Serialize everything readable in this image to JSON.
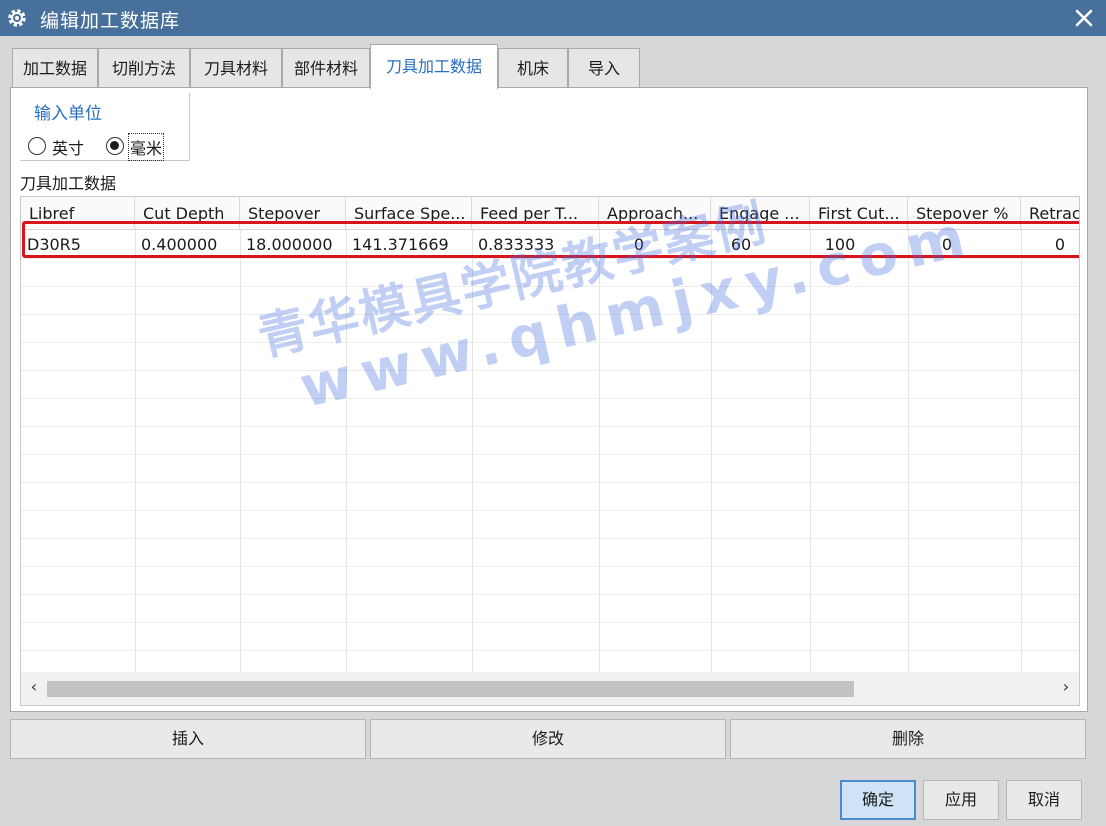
{
  "window": {
    "title": "编辑加工数据库",
    "icons": {
      "app": "gear-icon",
      "close": "close-icon"
    },
    "title_bar_color": "#47719c"
  },
  "tabs": [
    {
      "label": "加工数据",
      "active": false
    },
    {
      "label": "切削方法",
      "active": false
    },
    {
      "label": "刀具材料",
      "active": false
    },
    {
      "label": "部件材料",
      "active": false
    },
    {
      "label": "刀具加工数据",
      "active": true
    },
    {
      "label": "机床",
      "active": false
    },
    {
      "label": "导入",
      "active": false
    }
  ],
  "input_unit": {
    "title": "输入单位",
    "options": [
      {
        "label": "英寸",
        "selected": false
      },
      {
        "label": "毫米",
        "selected": true
      }
    ]
  },
  "table": {
    "section_label": "刀具加工数据",
    "columns": [
      "Libref",
      "Cut Depth",
      "Stepover",
      "Surface Spe...",
      "Feed per T...",
      "Approach...",
      "Engage ...",
      "First Cut...",
      "Stepover %",
      "Retrac"
    ],
    "rows": [
      [
        "D30R5",
        "0.400000",
        "18.000000",
        "141.371669",
        "0.833333",
        "0",
        "60",
        "100",
        "0",
        "0"
      ]
    ],
    "highlight_color": "#d9141b",
    "scroll_icons": {
      "left": "chevron-left-icon",
      "right": "chevron-right-icon"
    }
  },
  "actions": {
    "insert": "插入",
    "modify": "修改",
    "delete": "删除"
  },
  "footer": {
    "ok": "确定",
    "apply": "应用",
    "cancel": "取消"
  },
  "watermark": {
    "line1": "青华模具学院教学案例",
    "line2": "www.qhmjxy.com"
  }
}
